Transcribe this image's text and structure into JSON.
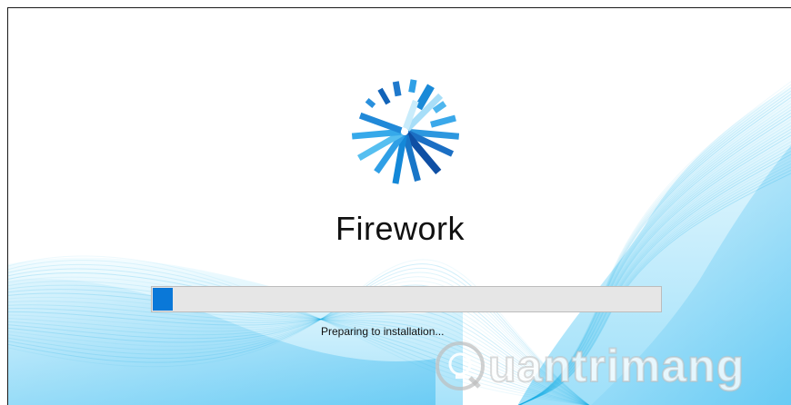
{
  "installer": {
    "app_name": "Firework",
    "status_text": "Preparing to installation...",
    "progress_fraction": 0.04,
    "logo_icon": "firework-burst-icon",
    "accent_color": "#0a78d8",
    "wave_color": "#17aee6"
  },
  "watermark": {
    "text": "uantrimang",
    "icon": "lightbulb-q-icon"
  }
}
